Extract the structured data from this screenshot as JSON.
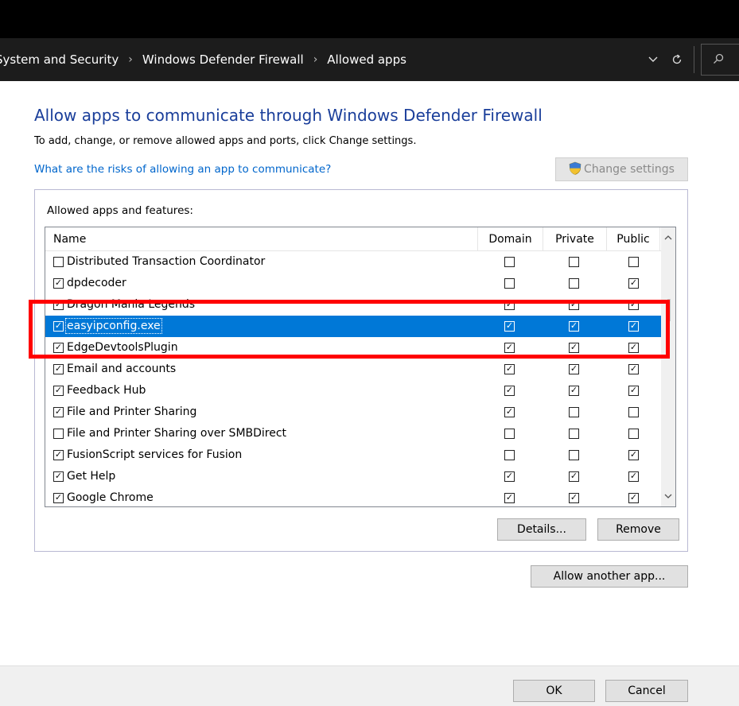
{
  "breadcrumb": {
    "items": [
      "System and Security",
      "Windows Defender Firewall",
      "Allowed apps"
    ]
  },
  "icons": {
    "chevron": "chevron-down-icon",
    "refresh": "refresh-icon",
    "search": "search-icon",
    "shield": "uac-shield-icon"
  },
  "colors": {
    "title": "#1a3e9a",
    "link": "#0066cc",
    "selection": "#0078d7",
    "highlight_box": "#ff0000"
  },
  "page": {
    "title": "Allow apps to communicate through Windows Defender Firewall",
    "subtitle": "To add, change, or remove allowed apps and ports, click Change settings.",
    "risk_link": "What are the risks of allowing an app to communicate?",
    "change_settings": "Change settings"
  },
  "group": {
    "label": "Allowed apps and features:",
    "columns": {
      "name": "Name",
      "domain": "Domain",
      "private": "Private",
      "public": "Public"
    },
    "selected_row": "easyipconfig.exe",
    "rows": [
      {
        "name": "Distributed Transaction Coordinator",
        "enabled": false,
        "domain": false,
        "private": false,
        "public": false
      },
      {
        "name": "dpdecoder",
        "enabled": true,
        "domain": false,
        "private": false,
        "public": true
      },
      {
        "name": "Dragon Mania Legends",
        "enabled": true,
        "domain": true,
        "private": true,
        "public": true
      },
      {
        "name": "easyipconfig.exe",
        "enabled": true,
        "domain": true,
        "private": true,
        "public": true
      },
      {
        "name": "EdgeDevtoolsPlugin",
        "enabled": true,
        "domain": true,
        "private": true,
        "public": true
      },
      {
        "name": "Email and accounts",
        "enabled": true,
        "domain": true,
        "private": true,
        "public": true
      },
      {
        "name": "Feedback Hub",
        "enabled": true,
        "domain": true,
        "private": true,
        "public": true
      },
      {
        "name": "File and Printer Sharing",
        "enabled": true,
        "domain": true,
        "private": false,
        "public": false
      },
      {
        "name": "File and Printer Sharing over SMBDirect",
        "enabled": false,
        "domain": false,
        "private": false,
        "public": false
      },
      {
        "name": "FusionScript services for Fusion",
        "enabled": true,
        "domain": false,
        "private": false,
        "public": true
      },
      {
        "name": "Get Help",
        "enabled": true,
        "domain": true,
        "private": true,
        "public": true
      },
      {
        "name": "Google Chrome",
        "enabled": true,
        "domain": true,
        "private": true,
        "public": true
      }
    ],
    "details_button": "Details...",
    "remove_button": "Remove"
  },
  "allow_another_app": "Allow another app...",
  "footer": {
    "ok": "OK",
    "cancel": "Cancel"
  }
}
